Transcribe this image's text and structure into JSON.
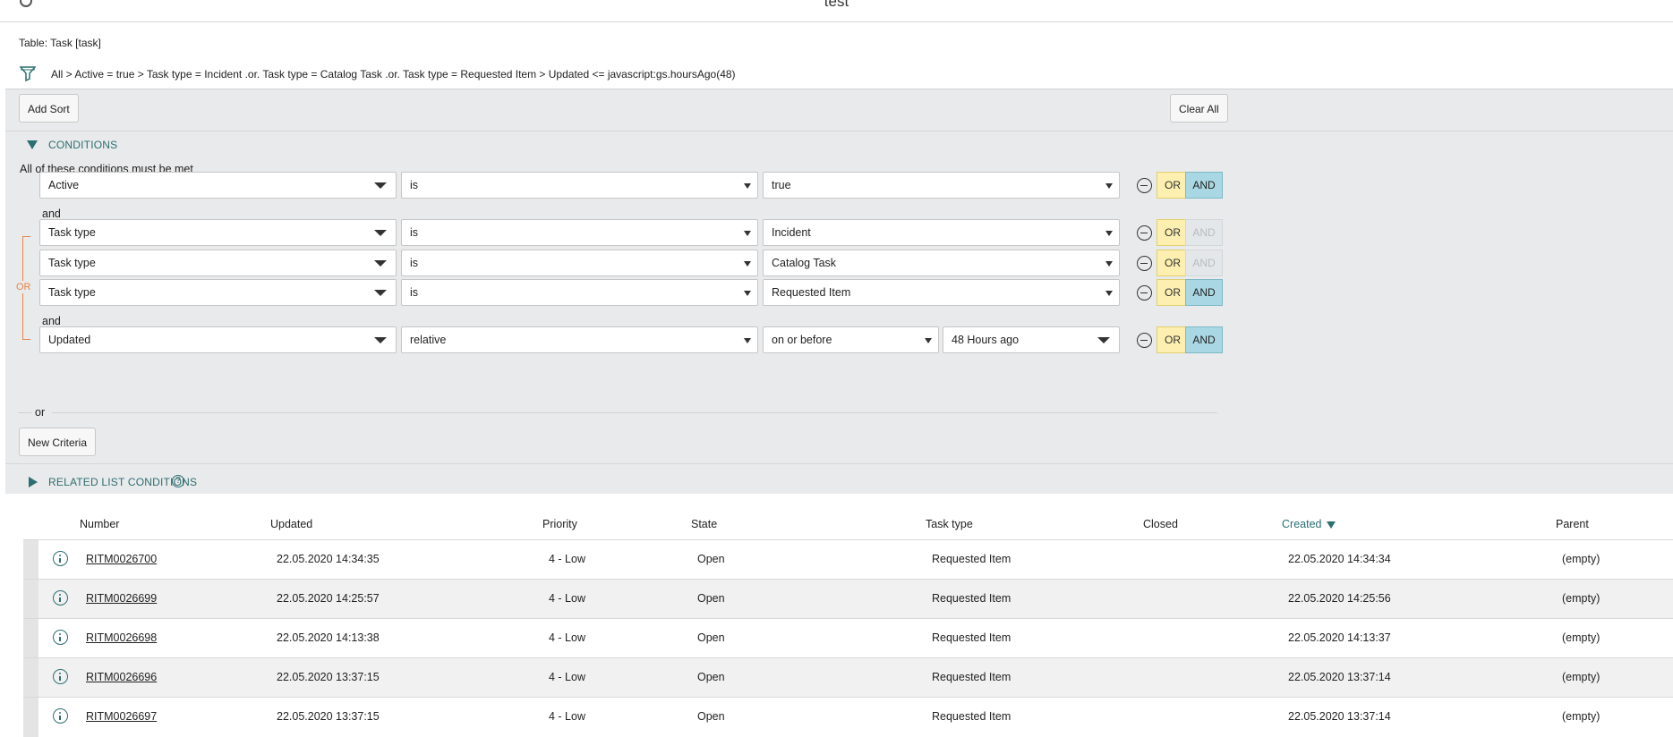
{
  "window": {
    "title": "test"
  },
  "table_label": "Table: Task [task]",
  "breadcrumb": "All > Active = true > Task type = Incident .or. Task type = Catalog Task .or. Task type = Requested Item > Updated <= javascript:gs.hoursAgo(48)",
  "toolbar": {
    "add_sort": "Add Sort",
    "clear_all": "Clear All"
  },
  "conditions": {
    "header": "CONDITIONS",
    "must_met": "All of these conditions must be met",
    "and_label": "and",
    "or_tag": "OR",
    "or_label": "or",
    "or_btn": "OR",
    "and_btn": "AND",
    "rows": [
      {
        "field": "Active",
        "operator": "is",
        "value": "true"
      },
      {
        "field": "Task type",
        "operator": "is",
        "value": "Incident"
      },
      {
        "field": "Task type",
        "operator": "is",
        "value": "Catalog Task"
      },
      {
        "field": "Task type",
        "operator": "is",
        "value": "Requested Item"
      },
      {
        "field": "Updated",
        "operator": "relative",
        "value": "on or before",
        "value2": "48 Hours ago"
      }
    ],
    "new_criteria": "New Criteria"
  },
  "related": {
    "header": "RELATED LIST CONDITIONS",
    "help": "?"
  },
  "list": {
    "columns": [
      "Number",
      "Updated",
      "Priority",
      "State",
      "Task type",
      "Closed",
      "Created",
      "Parent"
    ],
    "rows": [
      {
        "number": "RITM0026700",
        "updated": "22.05.2020 14:34:35",
        "priority": "4 - Low",
        "state": "Open",
        "task_type": "Requested Item",
        "closed": "",
        "created": "22.05.2020 14:34:34",
        "parent": "(empty)"
      },
      {
        "number": "RITM0026699",
        "updated": "22.05.2020 14:25:57",
        "priority": "4 - Low",
        "state": "Open",
        "task_type": "Requested Item",
        "closed": "",
        "created": "22.05.2020 14:25:56",
        "parent": "(empty)"
      },
      {
        "number": "RITM0026698",
        "updated": "22.05.2020 14:13:38",
        "priority": "4 - Low",
        "state": "Open",
        "task_type": "Requested Item",
        "closed": "",
        "created": "22.05.2020 14:13:37",
        "parent": "(empty)"
      },
      {
        "number": "RITM0026696",
        "updated": "22.05.2020 13:37:15",
        "priority": "4 - Low",
        "state": "Open",
        "task_type": "Requested Item",
        "closed": "",
        "created": "22.05.2020 13:37:14",
        "parent": "(empty)"
      },
      {
        "number": "RITM0026697",
        "updated": "22.05.2020 13:37:15",
        "priority": "4 - Low",
        "state": "Open",
        "task_type": "Requested Item",
        "closed": "",
        "created": "22.05.2020 13:37:14",
        "parent": "(empty)"
      }
    ]
  },
  "colors": {
    "accent": "#2c6e71",
    "or_yellow": "#fcefb0",
    "and_blue": "#a9d7e3",
    "or_bracket": "#e5864a"
  }
}
